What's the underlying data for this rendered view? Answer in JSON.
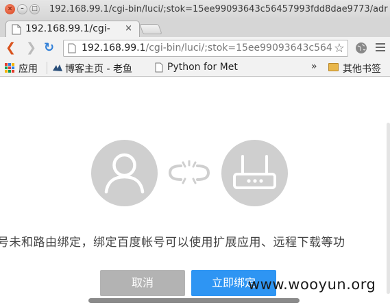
{
  "window": {
    "title": "192.168.99.1/cgi-bin/luci/;stok=15ee99093643c56457993fdd8dae9773/adr"
  },
  "tab": {
    "title": "192.168.99.1/cgi-",
    "close": "×"
  },
  "toolbar": {
    "url_host": "192.168.99.1",
    "url_path": "/cgi-bin/luci/;stok=15ee99093643c564",
    "star": "☆"
  },
  "bookmarks": {
    "apps_label": "应用",
    "items": [
      {
        "label": "博客主页 - 老鱼"
      },
      {
        "label": "Python for Met"
      }
    ],
    "more": "»",
    "other_label": "其他书签"
  },
  "content": {
    "message": "号未和路由绑定，绑定百度帐号可以使用扩展应用、远程下载等功",
    "cancel_label": "取消",
    "confirm_label": "立即绑定",
    "watermark": "www.wooyun.org"
  },
  "colors": {
    "confirm_button": "#2e95f3",
    "cancel_button": "#b3b3b3",
    "icon_circle": "#cfcfcf"
  }
}
